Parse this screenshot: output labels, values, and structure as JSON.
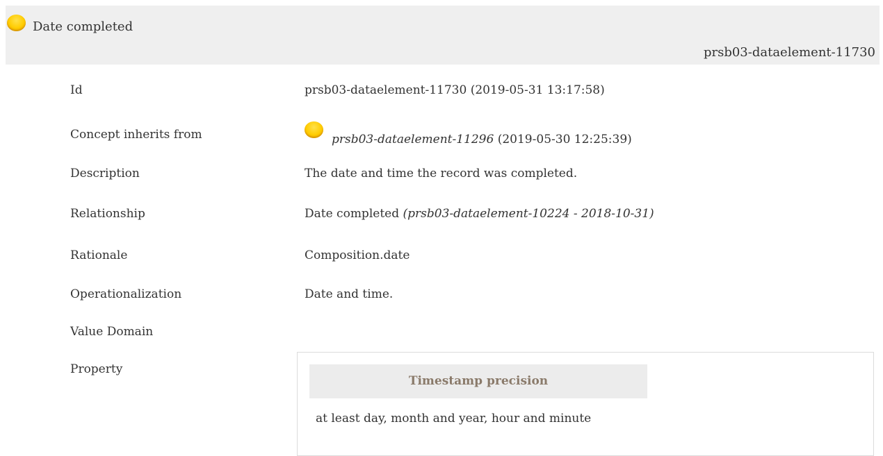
{
  "header": {
    "title": "Date completed",
    "id": "prsb03-dataelement-11730",
    "status_color": "#ffcc00"
  },
  "fields": {
    "id": {
      "label": "Id",
      "value": "prsb03-dataelement-11730 (2019-05-31 13:17:58)"
    },
    "inherits": {
      "label": "Concept inherits from",
      "link": "prsb03-dataelement-11296",
      "suffix": " (2019-05-30 12:25:39)"
    },
    "description": {
      "label": "Description",
      "value": "The date and time the record was completed."
    },
    "relationship": {
      "label": "Relationship",
      "value": "Date completed ",
      "ref": "(prsb03-dataelement-10224 - 2018-10-31)"
    },
    "rationale": {
      "label": "Rationale",
      "value": "Composition.date"
    },
    "operationalization": {
      "label": "Operationalization",
      "value": "Date and time."
    },
    "value_domain": {
      "label": "Value Domain"
    },
    "property": {
      "label": "Property",
      "header": "Timestamp precision",
      "value": "at least day, month and year, hour and minute"
    }
  }
}
